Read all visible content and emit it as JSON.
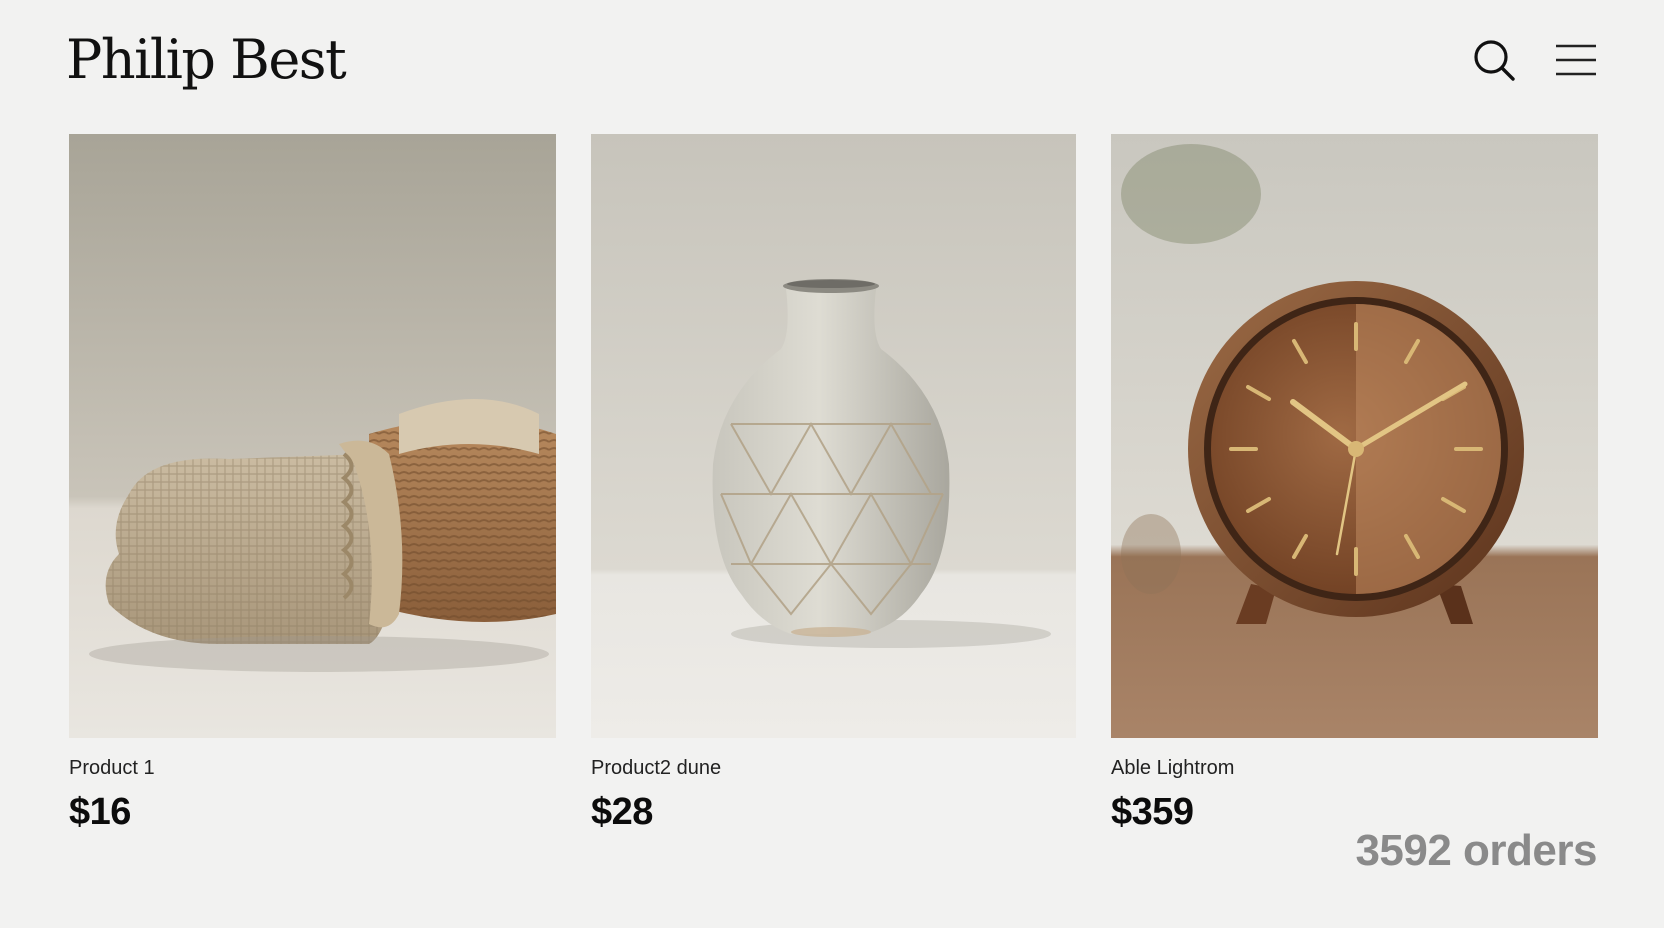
{
  "header": {
    "brand": "Philip Best",
    "icons": [
      "search-icon",
      "menu-icon"
    ]
  },
  "products": [
    {
      "name": "Product 1",
      "price": "$16",
      "image": "folded-knit-blanket"
    },
    {
      "name": "Product2 dune",
      "price": "$28",
      "image": "geometric-ceramic-vase"
    },
    {
      "name": "Able Lightrom",
      "price": "$359",
      "image": "wooden-desk-clock"
    }
  ],
  "footer": {
    "orders": "3592 orders"
  },
  "colors": {
    "background": "#f2f2f1",
    "text": "#111111",
    "muted": "#8a8a8a"
  }
}
